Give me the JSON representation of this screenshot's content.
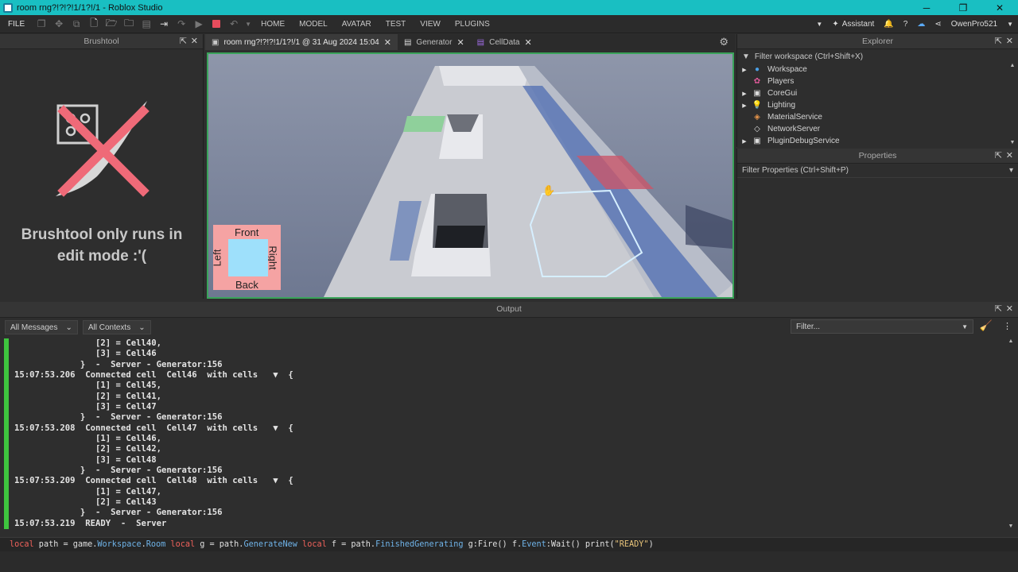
{
  "window": {
    "title": "room rng?!?!?!1/1?!/1 - Roblox Studio",
    "min": "─",
    "max": "❐",
    "close": "✕"
  },
  "menubar": {
    "file": "FILE",
    "tabs": [
      "HOME",
      "MODEL",
      "AVATAR",
      "TEST",
      "VIEW",
      "PLUGINS"
    ],
    "assistant": "Assistant",
    "user": "OwenPro521"
  },
  "brushtool": {
    "title": "Brushtool",
    "message_line1": "Brushtool only runs in",
    "message_line2": "edit mode :'("
  },
  "doc_tabs": [
    {
      "label": "room rng?!?!?!1/1?!/1 @ 31 Aug 2024 15:04",
      "active": true,
      "icon": "place-icon"
    },
    {
      "label": "Generator",
      "active": false,
      "icon": "script-icon"
    },
    {
      "label": "CellData",
      "active": false,
      "icon": "module-script-icon"
    }
  ],
  "viewport": {
    "direction_labels": {
      "front": "Front",
      "back": "Back",
      "left": "Left",
      "right": "Right"
    }
  },
  "explorer": {
    "title": "Explorer",
    "filter_placeholder": "Filter workspace (Ctrl+Shift+X)",
    "items": [
      {
        "label": "Workspace",
        "expandable": true,
        "icon": "globe-icon"
      },
      {
        "label": "Players",
        "expandable": false,
        "icon": "players-icon"
      },
      {
        "label": "CoreGui",
        "expandable": true,
        "icon": "coregui-icon"
      },
      {
        "label": "Lighting",
        "expandable": true,
        "icon": "lightbulb-icon"
      },
      {
        "label": "MaterialService",
        "expandable": false,
        "icon": "material-icon"
      },
      {
        "label": "NetworkServer",
        "expandable": false,
        "icon": "network-icon"
      },
      {
        "label": "PluginDebugService",
        "expandable": true,
        "icon": "debug-icon"
      }
    ]
  },
  "properties": {
    "title": "Properties",
    "filter_placeholder": "Filter Properties (Ctrl+Shift+P)"
  },
  "output": {
    "title": "Output",
    "messages_dropdown": "All Messages",
    "contexts_dropdown": "All Contexts",
    "filter_placeholder": "Filter...",
    "lines": [
      "                [2] = Cell40,",
      "                [3] = Cell46",
      "             }  -  Server - Generator:156",
      "15:07:53.206  Connected cell  Cell46  with cells   ▼  {",
      "                [1] = Cell45,",
      "                [2] = Cell41,",
      "                [3] = Cell47",
      "             }  -  Server - Generator:156",
      "15:07:53.208  Connected cell  Cell47  with cells   ▼  {",
      "                [1] = Cell46,",
      "                [2] = Cell42,",
      "                [3] = Cell48",
      "             }  -  Server - Generator:156",
      "15:07:53.209  Connected cell  Cell48  with cells   ▼  {",
      "                [1] = Cell47,",
      "                [2] = Cell43",
      "             }  -  Server - Generator:156",
      "15:07:53.219  READY  -  Server"
    ]
  },
  "command_bar": {
    "tokens": [
      {
        "t": "local",
        "c": "kw"
      },
      {
        "t": " path = game.",
        "c": ""
      },
      {
        "t": "Workspace",
        "c": "prop"
      },
      {
        "t": ".",
        "c": ""
      },
      {
        "t": "Room",
        "c": "prop"
      },
      {
        "t": " local",
        "c": "kw"
      },
      {
        "t": " g = path.",
        "c": ""
      },
      {
        "t": "GenerateNew",
        "c": "prop"
      },
      {
        "t": " local",
        "c": "kw"
      },
      {
        "t": " f = path.",
        "c": ""
      },
      {
        "t": "FinishedGenerating",
        "c": "prop"
      },
      {
        "t": " g:Fire() f.",
        "c": ""
      },
      {
        "t": "Event",
        "c": "prop"
      },
      {
        "t": ":Wait() print(",
        "c": ""
      },
      {
        "t": "\"READY\"",
        "c": "str"
      },
      {
        "t": ")",
        "c": ""
      }
    ]
  },
  "colors": {
    "titlebar": "#19bfc2",
    "output_bar": "#3ec43e",
    "stop": "#e74c5c",
    "keyword": "#f0625b"
  }
}
